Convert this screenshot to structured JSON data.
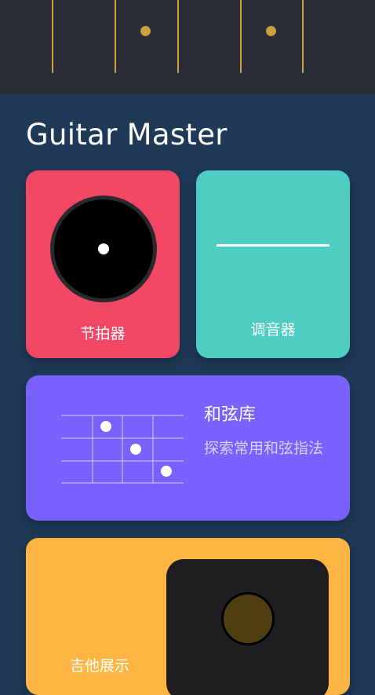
{
  "app": {
    "title": "Guitar Master"
  },
  "fretboard": {
    "frets": 6,
    "inlays": 2
  },
  "cards": {
    "metronome": {
      "label": "节拍器",
      "color": "#f34865"
    },
    "tuner": {
      "label": "调音器",
      "color": "#4fcdc3"
    },
    "chords": {
      "title": "和弦库",
      "subtitle": "探索常用和弦指法",
      "color": "#7961fd"
    },
    "guitar": {
      "label": "吉他展示",
      "color": "#ffb543"
    }
  },
  "colors": {
    "background": "#1f3a57",
    "fretboard": "#2a2c36",
    "fret_gold": "#c9a23b"
  }
}
